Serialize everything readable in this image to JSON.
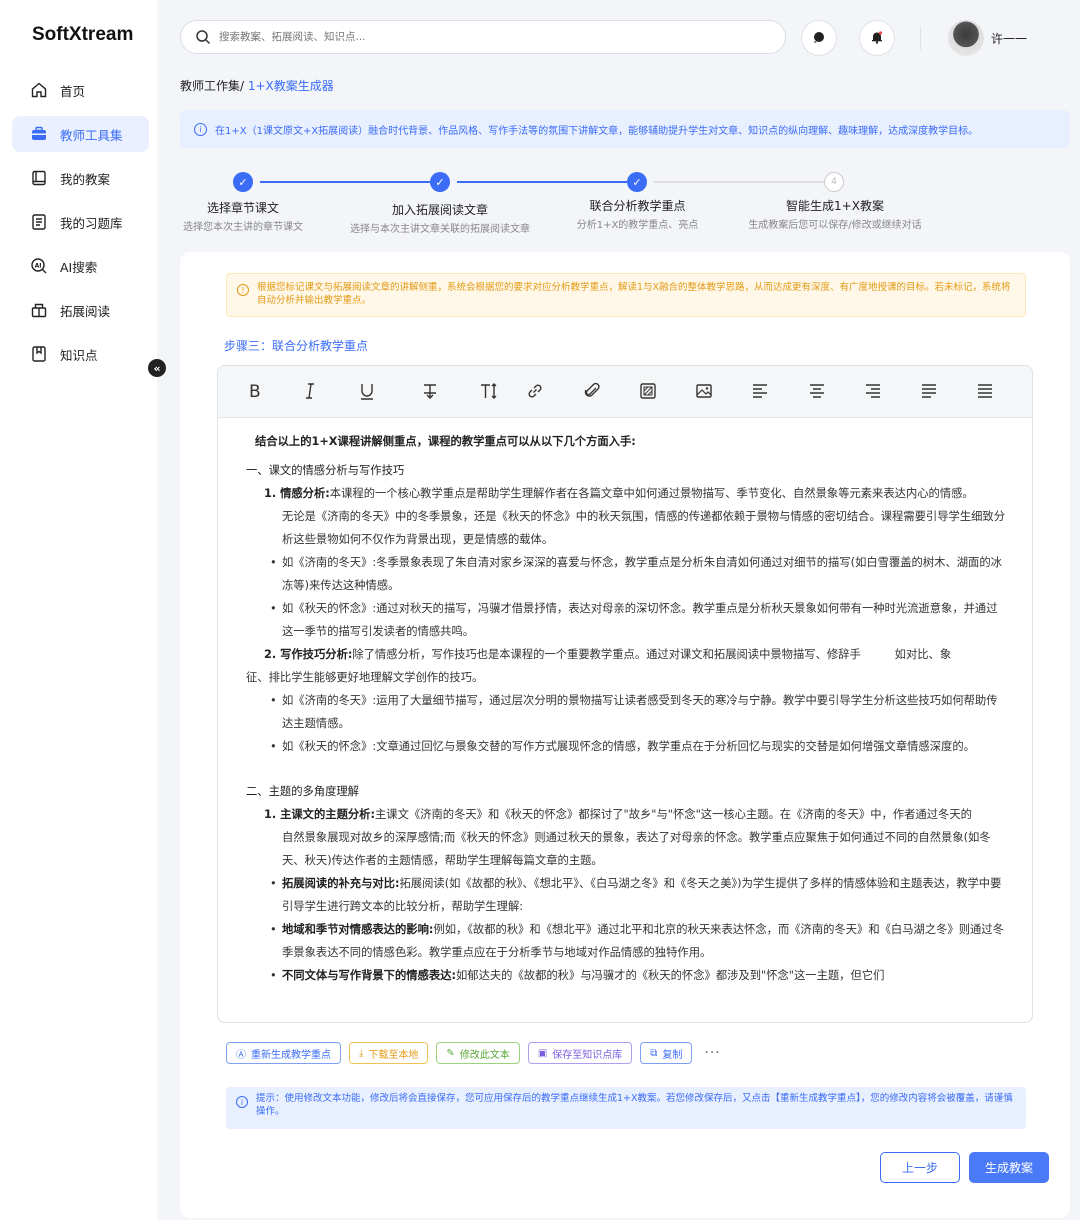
{
  "app": {
    "logo": "SoftXtream"
  },
  "sidebar": {
    "items": [
      {
        "label": "首页",
        "icon": "home-icon"
      },
      {
        "label": "教师工具集",
        "icon": "toolbox-icon",
        "active": true
      },
      {
        "label": "我的教案",
        "icon": "book-icon"
      },
      {
        "label": "我的习题库",
        "icon": "document-icon"
      },
      {
        "label": "AI搜索",
        "icon": "ai-search-icon"
      },
      {
        "label": "拓展阅读",
        "icon": "reading-icon"
      },
      {
        "label": "知识点",
        "icon": "bookmark-icon"
      }
    ],
    "collapse_glyph": "«"
  },
  "header": {
    "search_placeholder": "搜索教案、拓展阅读、知识点...",
    "user_name": "许一一"
  },
  "breadcrumb": {
    "parent": "教师工作集/",
    "current": " 1+X教案生成器"
  },
  "info_banner": "在1+X（1课文原文+X拓展阅读）融合时代背景、作品风格、写作手法等的氛围下讲解文章，能够辅助提升学生对文章、知识点的纵向理解、趣味理解，达成深度教学目标。",
  "steps": [
    {
      "title": "选择章节课文",
      "desc": "选择您本次主讲的章节课文",
      "status": "done"
    },
    {
      "title": "加入拓展阅读文章",
      "desc": "选择与本次主讲文章关联的拓展阅读文章",
      "status": "done"
    },
    {
      "title": "联合分析教学重点",
      "desc": "分析1+X的教学重点、亮点",
      "status": "done"
    },
    {
      "title": "智能生成1+X教案",
      "desc": "生成教案后您可以保存/修改或继续对话",
      "status": "pending",
      "number": "4"
    }
  ],
  "warning": "根据您标记课文与拓展阅读文章的讲解侧重，系统会根据您的要求对应分析教学重点，解读1与X融合的整体教学思路，从而达成更有深度、有广度地授课的目标。若未标记，系统将自动分析并输出教学重点。",
  "section_label": "步骤三：联合分析教学重点",
  "editor": {
    "intro": "结合以上的1+X课程讲解侧重点，课程的教学重点可以从以下几个方面入手:",
    "h1": "一、课文的情感分析与写作技巧",
    "p1_bold": "1. 情感分析:",
    "p1_text": "本课程的一个核心教学重点是帮助学生理解作者在各篇文章中如何通过景物描写、季节变化、自然景象等元素来表达内心的情感。",
    "p1_cont": "无论是《济南的冬天》中的冬季景象，还是《秋天的怀念》中的秋天氛围，情感的传递都依赖于景物与情感的密切结合。课程需要引导学生细致分析这些景物如何不仅作为背景出现，更是情感的载体。",
    "b1": "如《济南的冬天》:冬季景象表现了朱自清对家乡深深的喜爱与怀念，教学重点是分析朱自清如何通过对细节的描写(如白雪覆盖的树木、湖面的冰冻等)来传达这种情感。",
    "b2": "如《秋天的怀念》:通过对秋天的描写，冯骥才借景抒情，表达对母亲的深切怀念。教学重点是分析秋天景象如何带有一种时光流逝意象，并通过这一季节的描写引发读者的情感共鸣。",
    "p2_bold": "2. 写作技巧分析:",
    "p2_text": "除了情感分析，写作技巧也是本课程的一个重要教学重点。通过对课文和拓展阅读中景物描写、修辞手　　　如对比、象",
    "p2_cont": "征、排比学生能够更好地理解文学创作的技巧。",
    "b3": "如《济南的冬天》:运用了大量细节描写，通过层次分明的景物描写让读者感受到冬天的寒冷与宁静。教学中要引导学生分析这些技巧如何帮助传达主题情感。",
    "b4": "如《秋天的怀念》:文章通过回忆与景象交替的写作方式展现怀念的情感，教学重点在于分析回忆与现实的交替是如何增强文章情感深度的。",
    "h2": "二、主题的多角度理解",
    "p3_bold": "1. 主课文的主题分析:",
    "p3_text": "主课文《济南的冬天》和《秋天的怀念》都探讨了\"故乡\"与\"怀念\"这一核心主题。在《济南的冬天》中，作者通过冬天的",
    "p3_cont": "自然景象展现对故乡的深厚感情;而《秋天的怀念》则通过秋天的景象，表达了对母亲的怀念。教学重点应聚焦于如何通过不同的自然景象(如冬天、秋天)传达作者的主题情感，帮助学生理解每篇文章的主题。",
    "b5_bold": "拓展阅读的补充与对比:",
    "b5_text": "拓展阅读(如《故都的秋》、《想北平》、《白马湖之冬》和《冬天之美》)为学生提供了多样的情感体验和主题表达，教学中要引导学生进行跨文本的比较分析，帮助学生理解:",
    "b6_bold": "地域和季节对情感表达的影响:",
    "b6_text": "例如，《故都的秋》和《想北平》通过北平和北京的秋天来表达怀念，而《济南的冬天》和《白马湖之冬》则通过冬季景象表达不同的情感色彩。教学重点应在于分析季节与地域对作品情感的独特作用。",
    "b7_bold": "不同文体与写作背景下的情感表达:",
    "b7_text": "如郁达夫的《故都的秋》与冯骥才的《秋天的怀念》都涉及到\"怀念\"这一主题，但它们"
  },
  "actions": {
    "regen": "重新生成教学重点",
    "download": "下载至本地",
    "edit": "修改此文本",
    "save": "保存至知识点库",
    "copy": "复制",
    "more": "···"
  },
  "tip": "提示：使用修改文本功能，修改后将会直接保存，您可应用保存后的教学重点继续生成1+X教案。若您修改保存后，又点击【重新生成教学重点】，您的修改内容将会被覆盖，请谨慎操作。",
  "buttons": {
    "prev": "上一步",
    "next": "生成教案"
  },
  "colors": {
    "accent": "#3b6cf6",
    "warning": "#e39b17",
    "active_bg": "#eaf0ff"
  }
}
